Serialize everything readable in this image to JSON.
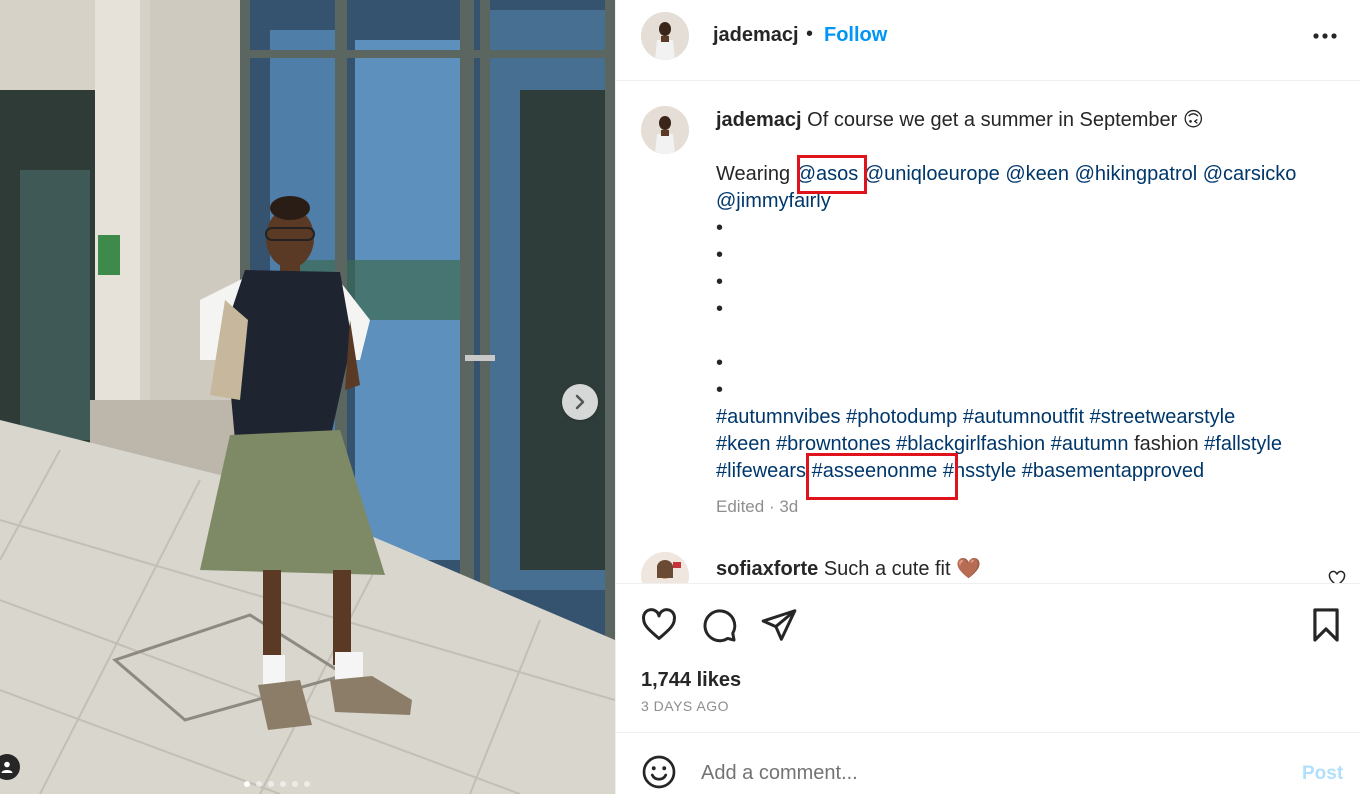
{
  "post": {
    "username": "jademacj",
    "separator": "•",
    "follow_label": "Follow",
    "more_icon": "more-horizontal-icon"
  },
  "caption": {
    "username": "jademacj",
    "text": "Of course we get a summer in September 🙃",
    "wearing_label": "Wearing",
    "mentions": [
      "@asos",
      "@uniqloeurope",
      "@keen",
      "@hikingpatrol",
      "@carsicko",
      "@jimmyfairly"
    ],
    "bullets": [
      "•",
      "•",
      "•",
      "•",
      "•",
      "•"
    ],
    "hashtags_line1": [
      "#autumnvibes",
      "#photodump",
      "#autumnoutfit",
      "#streetwearstyle"
    ],
    "hashtags_line2a": [
      "#keen",
      "#browntones",
      "#blackgirlfashion",
      "#autumn"
    ],
    "plain_word": "fashion",
    "hashtags_line2b": [
      "#fallstyle"
    ],
    "hashtags_line3": [
      "#lifewears",
      "#asseenonme",
      "#hsstyle",
      "#basementapproved"
    ],
    "edited": "Edited",
    "dot": "·",
    "age": "3d"
  },
  "comment": {
    "username": "sofiaxforte",
    "text": "Such a cute fit 🤎"
  },
  "actions": {
    "like_icon": "heart-icon",
    "comment_icon": "comment-icon",
    "share_icon": "send-icon",
    "save_icon": "bookmark-icon"
  },
  "likes": "1,744 likes",
  "posted_ago": "3 DAYS AGO",
  "add_comment": {
    "placeholder": "Add a comment...",
    "post_label": "Post"
  },
  "carousel": {
    "dot_count": 6,
    "active_index": 0
  },
  "highlight_color": "#e0121b",
  "link_color": "#00376b",
  "follow_color": "#0095f6"
}
